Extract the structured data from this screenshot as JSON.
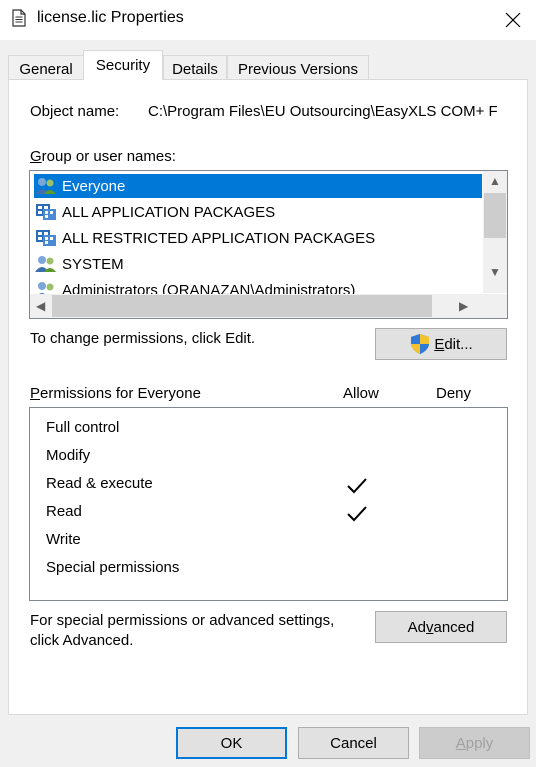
{
  "window": {
    "title": "license.lic Properties"
  },
  "tabs": [
    {
      "label": "General",
      "active": false
    },
    {
      "label": "Security",
      "active": true
    },
    {
      "label": "Details",
      "active": false
    },
    {
      "label": "Previous Versions",
      "active": false
    }
  ],
  "security": {
    "object_name_label": "Object name:",
    "object_name_value": "C:\\Program Files\\EU Outsourcing\\EasyXLS COM+ F",
    "group_label_first": "G",
    "group_label_rest": "roup or user names:",
    "users": [
      {
        "name": "Everyone",
        "icon": "group-users-icon",
        "selected": true
      },
      {
        "name": "ALL APPLICATION PACKAGES",
        "icon": "app-packages-icon",
        "selected": false
      },
      {
        "name": "ALL RESTRICTED APPLICATION PACKAGES",
        "icon": "app-packages-icon",
        "selected": false
      },
      {
        "name": "SYSTEM",
        "icon": "group-users-icon",
        "selected": false
      },
      {
        "name": "Administrators (ORANAZAN\\Administrators)",
        "icon": "group-users-icon",
        "selected": false
      }
    ],
    "change_text": "To change permissions, click Edit.",
    "edit_button_first": "E",
    "edit_button_rest": "dit...",
    "permissions_label_first": "P",
    "permissions_label_rest": "ermissions for Everyone",
    "allow_header": "Allow",
    "deny_header": "Deny",
    "permissions": [
      {
        "name": "Full control",
        "allow": false,
        "deny": false
      },
      {
        "name": "Modify",
        "allow": false,
        "deny": false
      },
      {
        "name": "Read & execute",
        "allow": true,
        "deny": false
      },
      {
        "name": "Read",
        "allow": true,
        "deny": false
      },
      {
        "name": "Write",
        "allow": false,
        "deny": false
      },
      {
        "name": "Special permissions",
        "allow": false,
        "deny": false
      }
    ],
    "advanced_text_line1": "For special permissions or advanced settings,",
    "advanced_text_line2": "click Advanced.",
    "advanced_button_pre": "Ad",
    "advanced_button_underlined": "v",
    "advanced_button_post": "anced"
  },
  "footer": {
    "ok_label": "OK",
    "cancel_label": "Cancel",
    "apply_first": "A",
    "apply_rest": "pply"
  },
  "colors": {
    "accent": "#0078d7",
    "selection": "#0078d7"
  }
}
